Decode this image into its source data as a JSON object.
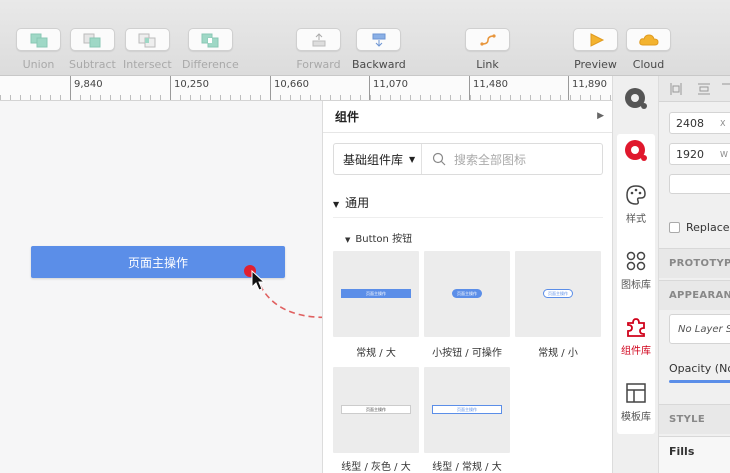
{
  "toolbar": {
    "union": "Union",
    "subtract": "Subtract",
    "intersect": "Intersect",
    "difference": "Difference",
    "forward": "Forward",
    "backward": "Backward",
    "link": "Link",
    "preview": "Preview",
    "cloud": "Cloud"
  },
  "ruler": {
    "marks": [
      "9,840",
      "10,250",
      "10,660",
      "11,070",
      "11,480",
      "11,890"
    ]
  },
  "canvas": {
    "main_button_label": "页面主操作"
  },
  "components": {
    "title": "组件",
    "library_select": "基础组件库",
    "search_placeholder": "搜索全部图标",
    "section": "通用",
    "subsection": "Button 按钮",
    "tiles": [
      {
        "label": "常规 / 大",
        "preview": "页面主操作"
      },
      {
        "label": "小按钮 / 可操作",
        "preview": "页面主操作"
      },
      {
        "label": "常规 / 小",
        "preview": "页面主操作"
      },
      {
        "label": "线型 / 灰色 / 大",
        "preview": "页面主操作"
      },
      {
        "label": "线型 / 常规 / 大",
        "preview": "页面主操作"
      }
    ]
  },
  "strip": {
    "style": "样式",
    "icon_lib": "图标库",
    "component_lib": "组件库",
    "template_lib": "模板库"
  },
  "inspector": {
    "x_value": "2408",
    "x_unit": "X",
    "w_value": "1920",
    "w_unit": "W",
    "replace": "Replace",
    "prototyping": "PROTOTYPING",
    "appearance": "APPEARANCE",
    "no_layer": "No Layer Style",
    "opacity": "Opacity (Normal)",
    "style": "STYLE",
    "fills": "Fills"
  },
  "colors": {
    "primary": "#5b8ee8",
    "accent_red": "#d0021b",
    "cursor_dot": "#e02030"
  }
}
